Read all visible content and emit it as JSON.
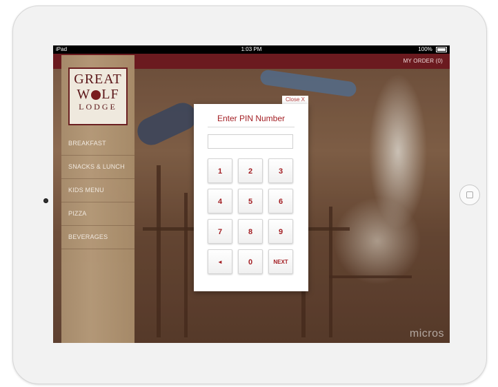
{
  "status_bar": {
    "device": "iPad",
    "time": "1:03 PM",
    "battery": "100%"
  },
  "header": {
    "my_order": "MY ORDER (0)"
  },
  "logo": {
    "line1": "GREAT",
    "line2": "W   LF",
    "line3": "LODGE"
  },
  "menu": [
    {
      "label": "BREAKFAST"
    },
    {
      "label": "SNACKS & LUNCH"
    },
    {
      "label": "KIDS MENU"
    },
    {
      "label": "PIZZA"
    },
    {
      "label": "BEVERAGES"
    }
  ],
  "watermark": "micros",
  "pin_dialog": {
    "close_label": "Close  X",
    "title": "Enter PIN Number",
    "input_value": "",
    "keys": [
      "1",
      "2",
      "3",
      "4",
      "5",
      "6",
      "7",
      "8",
      "9",
      "◄",
      "0",
      "NEXT"
    ]
  },
  "colors": {
    "accent": "#a31e23",
    "header": "#6b1a1f"
  }
}
